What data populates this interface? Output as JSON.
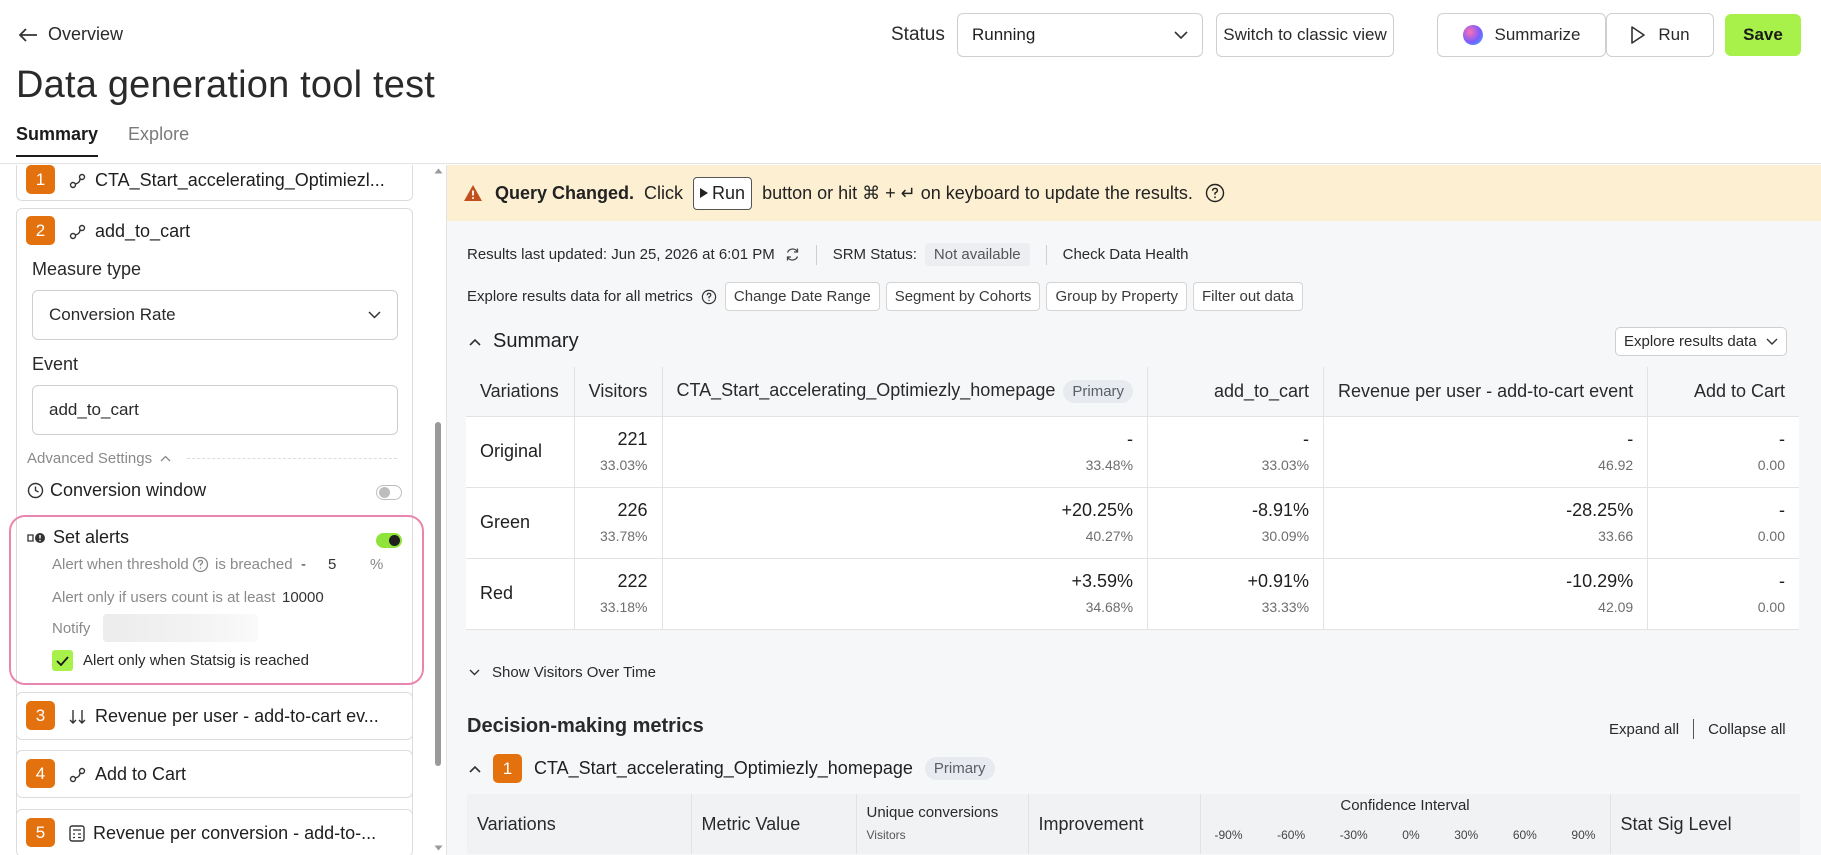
{
  "header": {
    "back_label": "Overview",
    "title": "Data generation tool test",
    "tabs": [
      {
        "label": "Summary",
        "active": true
      },
      {
        "label": "Explore",
        "active": false
      }
    ],
    "status_label": "Status",
    "status_value": "Running",
    "switch_label": "Switch to classic view",
    "summarize_label": "Summarize",
    "run_label": "Run",
    "save_label": "Save"
  },
  "left": {
    "metric1": {
      "num": "1",
      "name": "CTA_Start_accelerating_Optimiezl..."
    },
    "metric2": {
      "num": "2",
      "name": "add_to_cart",
      "measure_type_label": "Measure type",
      "measure_type_value": "Conversion Rate",
      "event_label": "Event",
      "event_value": "add_to_cart",
      "advanced_label": "Advanced Settings",
      "conversion_window_label": "Conversion window",
      "set_alerts_label": "Set alerts",
      "threshold_label": "Alert when threshold",
      "breached_label": "is breached",
      "threshold_sign": "-",
      "threshold_value": "5",
      "threshold_unit": "%",
      "users_label": "Alert only if users count is at least",
      "users_value": "10000",
      "notify_label": "Notify",
      "statsig_label": "Alert only when Statsig is reached"
    },
    "metric3": {
      "num": "3",
      "name": "Revenue per user - add-to-cart ev..."
    },
    "metric4": {
      "num": "4",
      "name": "Add to Cart"
    },
    "metric5": {
      "num": "5",
      "name": "Revenue per conversion - add-to-..."
    }
  },
  "banner": {
    "strong": "Query Changed.",
    "click": "Click",
    "run": "Run",
    "rest": "button or hit ⌘ + ↵ on keyboard to update the results."
  },
  "results": {
    "updated": "Results last updated: Jun 25, 2026 at 6:01 PM",
    "srm_label": "SRM Status:",
    "srm_value": "Not available",
    "health": "Check Data Health",
    "explore_label": "Explore results data for all metrics",
    "chips": [
      "Change Date Range",
      "Segment by Cohorts",
      "Group by Property",
      "Filter out data"
    ]
  },
  "summary": {
    "title": "Summary",
    "explore_btn": "Explore results data",
    "headers": [
      "Variations",
      "Visitors",
      "CTA_Start_accelerating_Optimiezly_homepage",
      "add_to_cart",
      "Revenue per user - add-to-cart event",
      "Add to Cart"
    ],
    "primary": "Primary",
    "rows": [
      {
        "name": "Original",
        "visitors": "221",
        "vis_pct": "33.03%",
        "c1": [
          "-",
          "33.48%"
        ],
        "c2": [
          "-",
          "33.03%"
        ],
        "c3": [
          "-",
          "46.92"
        ],
        "c4": [
          "-",
          "0.00"
        ]
      },
      {
        "name": "Green",
        "visitors": "226",
        "vis_pct": "33.78%",
        "c1": [
          "+20.25%",
          "40.27%"
        ],
        "c2": [
          "-8.91%",
          "30.09%"
        ],
        "c3": [
          "-28.25%",
          "33.66"
        ],
        "c4": [
          "-",
          "0.00"
        ]
      },
      {
        "name": "Red",
        "visitors": "222",
        "vis_pct": "33.18%",
        "c1": [
          "+3.59%",
          "34.68%"
        ],
        "c2": [
          "+0.91%",
          "33.33%"
        ],
        "c3": [
          "-10.29%",
          "42.09"
        ],
        "c4": [
          "-",
          "0.00"
        ]
      }
    ],
    "show_visitors": "Show Visitors Over Time"
  },
  "decision": {
    "title": "Decision-making metrics",
    "expand": "Expand all",
    "collapse": "Collapse all",
    "metric_num": "1",
    "metric_name": "CTA_Start_accelerating_Optimiezly_homepage",
    "primary": "Primary",
    "headers": {
      "variations": "Variations",
      "metric_value": "Metric Value",
      "unique": "Unique conversions",
      "visitors": "Visitors",
      "improvement": "Improvement",
      "ci": "Confidence Interval",
      "ticks": [
        "-90%",
        "-60%",
        "-30%",
        "0%",
        "30%",
        "60%",
        "90%"
      ],
      "stat_sig": "Stat Sig Level"
    }
  },
  "colors": {
    "accent_green": "#a8f04a",
    "metric_orange": "#e3720e",
    "banner_bg": "#fdefd2",
    "alert_highlight": "#e886ad"
  }
}
